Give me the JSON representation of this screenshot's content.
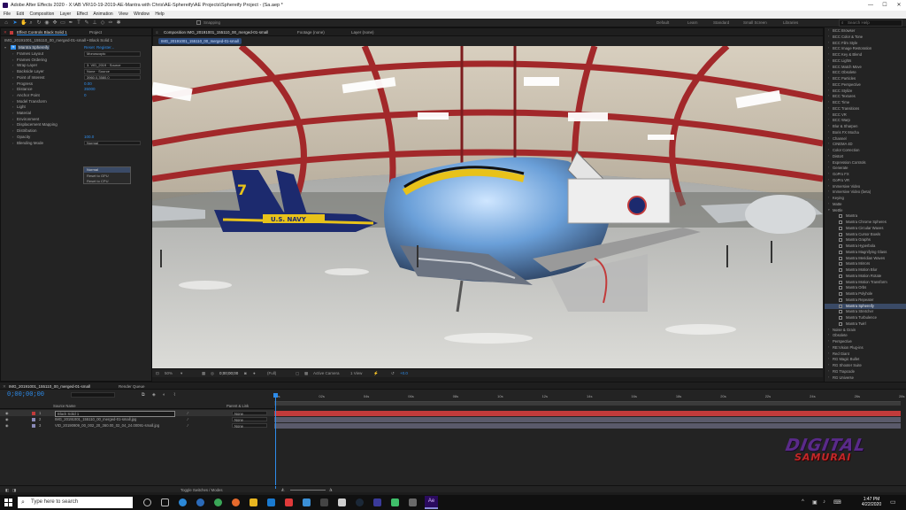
{
  "window": {
    "title": "Adobe After Effects 2020 - X:\\AB VR\\10-19-2019-AE-Mantra with Chris\\AE-Sphereify\\AE Projects\\Sphereify Project - (Sa.aep *",
    "minimize": "—",
    "maximize": "☐",
    "close": "✕"
  },
  "menu": [
    "File",
    "Edit",
    "Composition",
    "Layer",
    "Effect",
    "Animation",
    "View",
    "Window",
    "Help"
  ],
  "toolbar": {
    "snapping_label": "Snapping",
    "workspaces": [
      "Default",
      "Learn",
      "Standard",
      "Small Screen",
      "Libraries"
    ],
    "search_placeholder": "Search Help"
  },
  "effect_controls": {
    "tab_label": "Effect Controls Black Solid 1",
    "project_tab": "Project",
    "path": "IMG_20191001_155110_00_merged-01-small • Black Solid 1",
    "effect_name": "Mantra Sphereify",
    "reset": "Reset",
    "register": "Register...",
    "rows": [
      {
        "label": "Frames Layout",
        "value": "",
        "dropdown": "Monoscopic"
      },
      {
        "label": "Frames Ordering",
        "value": "",
        "dropdown": ""
      },
      {
        "label": "Wrap Layer",
        "value": "",
        "dropdown": "3. VID_2019  ·  Source"
      },
      {
        "label": "Backside Layer",
        "value": "",
        "dropdown": "None  ·  Source"
      },
      {
        "label": "Point of Interest",
        "value": "",
        "dropdown": "3960.0,3580.0"
      },
      {
        "label": "Progress",
        "value": "0.00",
        "dropdown": ""
      },
      {
        "label": "Distance",
        "value": "35000",
        "dropdown": ""
      },
      {
        "label": "Anchor Point",
        "value": "0",
        "dropdown": ""
      },
      {
        "label": "Model Transform",
        "value": "",
        "dropdown": ""
      },
      {
        "label": "Light",
        "value": "",
        "dropdown": ""
      },
      {
        "label": "Material",
        "value": "",
        "dropdown": ""
      },
      {
        "label": "Environment",
        "value": "",
        "dropdown": ""
      },
      {
        "label": "Displacement Mapping",
        "value": "",
        "dropdown": ""
      },
      {
        "label": "Distribution",
        "value": "",
        "dropdown": ""
      },
      {
        "label": "Opacity",
        "value": "100.0",
        "dropdown": ""
      },
      {
        "label": "Blending Mode",
        "value": "",
        "dropdown": "Normal"
      }
    ],
    "popup": [
      "Normal",
      "Reset to GPU",
      "Reset to CPU"
    ]
  },
  "composition": {
    "tab_label": "Composition IMG_20191001_155110_00_merged-01-small",
    "footage_tab": "Footage (none)",
    "layer_tab": "Layer (none)",
    "crumb": "IMG_20191001_155110_00_merged-01-small",
    "zoom": "50%",
    "timecode": "0;00;00;00",
    "resolution": "(Full)",
    "camera": "Active Camera",
    "views": "1 View",
    "exposure": "+0.0",
    "navy_text": "U.S. NAVY",
    "tail_number": "7"
  },
  "effects_presets": {
    "items": [
      {
        "label": "BCC Browser",
        "level": 0
      },
      {
        "label": "BCC Color & Tone",
        "level": 0
      },
      {
        "label": "BCC Film Style",
        "level": 0
      },
      {
        "label": "BCC Image Restoration",
        "level": 0
      },
      {
        "label": "BCC Key & Blend",
        "level": 0
      },
      {
        "label": "BCC Lights",
        "level": 0
      },
      {
        "label": "BCC Match Move",
        "level": 0
      },
      {
        "label": "BCC Obsolete",
        "level": 0
      },
      {
        "label": "BCC Particles",
        "level": 0
      },
      {
        "label": "BCC Perspective",
        "level": 0
      },
      {
        "label": "BCC Stylize",
        "level": 0
      },
      {
        "label": "BCC Textures",
        "level": 0
      },
      {
        "label": "BCC Time",
        "level": 0
      },
      {
        "label": "BCC Transitions",
        "level": 0
      },
      {
        "label": "BCC VR",
        "level": 0
      },
      {
        "label": "BCC Warp",
        "level": 0
      },
      {
        "label": "Blur & Sharpen",
        "level": 0
      },
      {
        "label": "Boris FX Mocha",
        "level": 0
      },
      {
        "label": "Channel",
        "level": 0
      },
      {
        "label": "CINEMA 4D",
        "level": 0
      },
      {
        "label": "Color Correction",
        "level": 0
      },
      {
        "label": "Distort",
        "level": 0
      },
      {
        "label": "Expression Controls",
        "level": 0
      },
      {
        "label": "Generate",
        "level": 0
      },
      {
        "label": "GoPro FX",
        "level": 0
      },
      {
        "label": "GoPro VR",
        "level": 0
      },
      {
        "label": "Immersive Video",
        "level": 0
      },
      {
        "label": "Immersive Video (beta)",
        "level": 0
      },
      {
        "label": "Keying",
        "level": 0
      },
      {
        "label": "Matte",
        "level": 0
      },
      {
        "label": "Mettle",
        "level": 0
      },
      {
        "label": "Mantra",
        "level": 1
      },
      {
        "label": "Mantra Chrome Spheres",
        "level": 1
      },
      {
        "label": "Mantra Circular Waves",
        "level": 1
      },
      {
        "label": "Mantra Cursor Bowls",
        "level": 1
      },
      {
        "label": "Mantra Graphs",
        "level": 1
      },
      {
        "label": "Mantra Hyperbola",
        "level": 1
      },
      {
        "label": "Mantra Magnifying Glass",
        "level": 1
      },
      {
        "label": "Mantra Meridian Waves",
        "level": 1
      },
      {
        "label": "Mantra Mirrors",
        "level": 1
      },
      {
        "label": "Mantra Motion Blur",
        "level": 1
      },
      {
        "label": "Mantra Motion Rotate",
        "level": 1
      },
      {
        "label": "Mantra Motion Transform",
        "level": 1
      },
      {
        "label": "Mantra Orbs",
        "level": 1
      },
      {
        "label": "Mantra Polyhole",
        "level": 1
      },
      {
        "label": "Mantra Repeater",
        "level": 1
      },
      {
        "label": "Mantra Sphereify",
        "level": 1
      },
      {
        "label": "Mantra Stretcher",
        "level": 1
      },
      {
        "label": "Mantra Turbulence",
        "level": 1
      },
      {
        "label": "Mantra Twirl",
        "level": 1
      },
      {
        "label": "Noise & Grain",
        "level": 0
      },
      {
        "label": "Obsolete",
        "level": 0
      },
      {
        "label": "Perspective",
        "level": 0
      },
      {
        "label": "RE:Vision Plug-ins",
        "level": 0
      },
      {
        "label": "Red Giant",
        "level": 0
      },
      {
        "label": "RG Magic Bullet",
        "level": 0
      },
      {
        "label": "RG Shooter Suite",
        "level": 0
      },
      {
        "label": "RG Trapcode",
        "level": 0
      },
      {
        "label": "RG Universe",
        "level": 0
      }
    ],
    "selected": "Mantra Sphereify"
  },
  "timeline": {
    "tab_label": "IMG_20191001_155110_00_merged-01-small",
    "render_tab": "Render Queue",
    "timecode": "0;00;00;00",
    "col_source": "Source Name",
    "col_parent": "Parent & Link",
    "ruler": [
      "00s",
      "02s",
      "04s",
      "06s",
      "08s",
      "10s",
      "12s",
      "14s",
      "16s",
      "18s",
      "20s",
      "22s",
      "24s",
      "26s",
      "28s"
    ],
    "layers": [
      {
        "num": "1",
        "name": "Black Solid 1",
        "parent": "None",
        "color": "#c23b3b"
      },
      {
        "num": "2",
        "name": "IMG_20191001_155110_00_merged-01-small.jpg",
        "parent": "None",
        "color": "#8a8ab8"
      },
      {
        "num": "3",
        "name": "VID_20190909_00_002_20_360.00_02_04_24.00091-small.jpg",
        "parent": "None",
        "color": "#8a8ab8"
      }
    ],
    "toggle_label": "Toggle Switches / Modes"
  },
  "watermark": {
    "line1": "DIGITAL",
    "line2": "SAMURAI"
  },
  "taskbar": {
    "search_placeholder": "Type here to search",
    "time": "1:47 PM",
    "date": "4/22/2020"
  },
  "colors": {
    "accent_blue": "#2d8ceb",
    "panel_bg": "#232323",
    "timeline_red": "#c23b3b",
    "timeline_gray": "#5a5a6a",
    "navy_blue": "#1c2a6e",
    "navy_yellow": "#e8c21a"
  }
}
